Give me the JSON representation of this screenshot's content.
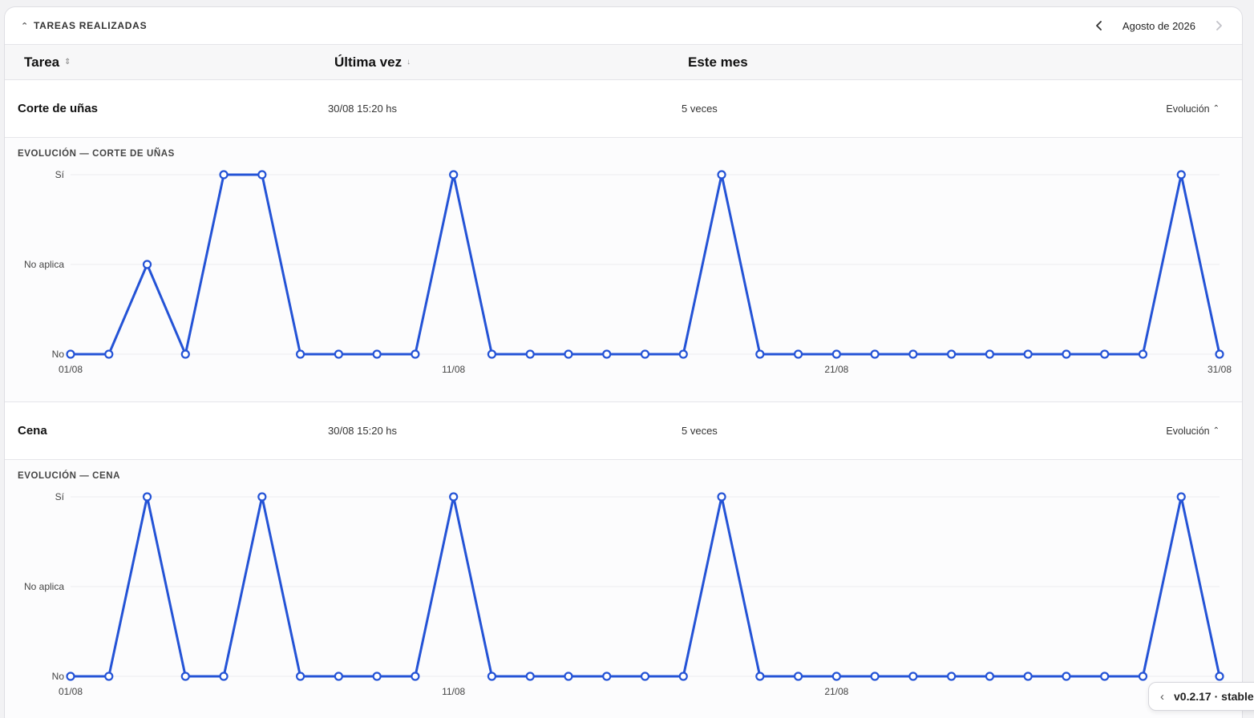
{
  "section": {
    "title": "TAREAS REALIZADAS",
    "month": "Agosto de 2026",
    "prev_icon": "chevron-left-icon",
    "next_icon": "chevron-right-icon",
    "collapse_icon": "chevron-up-icon"
  },
  "columns": {
    "task": "Tarea",
    "last": "Última vez",
    "month": "Este mes"
  },
  "rows": [
    {
      "name": "Corte de uñas",
      "last": "30/08 15:20 hs",
      "count": "5 veces",
      "evo_label": "Evolución",
      "panel_title": "EVOLUCIÓN — CORTE DE UÑAS"
    },
    {
      "name": "Cena",
      "last": "30/08 15:20 hs",
      "count": "5 veces",
      "evo_label": "Evolución",
      "panel_title": "EVOLUCIÓN — CENA"
    }
  ],
  "version": "v0.2.17 · stable",
  "accent_color": "#2453d6",
  "chart_data": [
    {
      "type": "line",
      "x": [
        1,
        2,
        3,
        4,
        5,
        6,
        7,
        8,
        9,
        10,
        11,
        12,
        13,
        14,
        15,
        16,
        17,
        18,
        19,
        20,
        21,
        22,
        23,
        24,
        25,
        26,
        27,
        28,
        29,
        30,
        31
      ],
      "x_tick_labels": [
        "01/08",
        "11/08",
        "21/08",
        "31/08"
      ],
      "x_tick_positions": [
        1,
        11,
        21,
        31
      ],
      "y_categories": [
        "No",
        "No aplica",
        "Sí"
      ],
      "series": [
        {
          "values": [
            0,
            0,
            1,
            0,
            2,
            2,
            0,
            0,
            0,
            0,
            2,
            0,
            0,
            0,
            0,
            0,
            0,
            2,
            0,
            0,
            0,
            0,
            0,
            0,
            0,
            0,
            0,
            0,
            0,
            2,
            0
          ]
        }
      ],
      "grid": true
    },
    {
      "type": "line",
      "x": [
        1,
        2,
        3,
        4,
        5,
        6,
        7,
        8,
        9,
        10,
        11,
        12,
        13,
        14,
        15,
        16,
        17,
        18,
        19,
        20,
        21,
        22,
        23,
        24,
        25,
        26,
        27,
        28,
        29,
        30,
        31
      ],
      "x_tick_labels": [
        "01/08",
        "11/08",
        "21/08"
      ],
      "x_tick_positions": [
        1,
        11,
        21
      ],
      "y_categories": [
        "No",
        "No aplica",
        "Sí"
      ],
      "series": [
        {
          "values": [
            0,
            0,
            2,
            0,
            0,
            2,
            0,
            0,
            0,
            0,
            2,
            0,
            0,
            0,
            0,
            0,
            0,
            2,
            0,
            0,
            0,
            0,
            0,
            0,
            0,
            0,
            0,
            0,
            0,
            2,
            0
          ]
        }
      ],
      "grid": true
    }
  ]
}
